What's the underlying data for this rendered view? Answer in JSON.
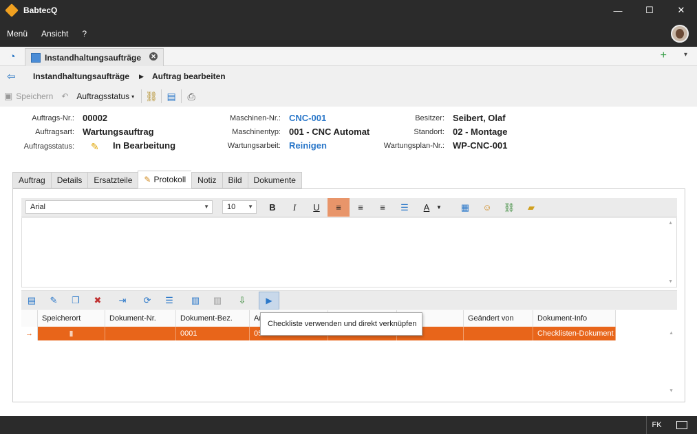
{
  "window": {
    "title": "BabtecQ",
    "minimize": "—",
    "maximize": "☐",
    "close": "✕"
  },
  "menu": [
    "Menü",
    "Ansicht",
    "?"
  ],
  "tabs": {
    "active_tab": "Instandhaltungsaufträge",
    "add": "+",
    "more": "▾"
  },
  "breadcrumb": {
    "root": "Instandhaltungsaufträge",
    "current": "Auftrag bearbeiten"
  },
  "toolbar": {
    "save": "Speichern",
    "status": "Auftragsstatus"
  },
  "order": {
    "nr_label": "Auftrags-Nr.:",
    "nr": "00002",
    "art_label": "Auftragsart:",
    "art": "Wartungsauftrag",
    "status_label": "Auftragsstatus:",
    "status": "In Bearbeitung",
    "machine_label": "Maschinen-Nr.:",
    "machine": "CNC-001",
    "type_label": "Maschinentyp:",
    "type": "001 - CNC Automat",
    "work_label": "Wartungsarbeit:",
    "work": "Reinigen",
    "owner_label": "Besitzer:",
    "owner": "Seibert, Olaf",
    "location_label": "Standort:",
    "location": "02 - Montage",
    "plan_label": "Wartungsplan-Nr.:",
    "plan": "WP-CNC-001"
  },
  "subtabs": [
    "Auftrag",
    "Details",
    "Ersatzteile",
    "Protokoll",
    "Notiz",
    "Bild",
    "Dokumente"
  ],
  "editor": {
    "font": "Arial",
    "size": "10"
  },
  "grid": {
    "headers": [
      "Speicherort",
      "Dokument-Nr.",
      "Dokument-Bez.",
      "An",
      "",
      "ert am",
      "Geändert von",
      "Dokument-Info"
    ],
    "row": {
      "marker": "→",
      "speicherort": "",
      "dok_nr": "",
      "dok_bez": "0001",
      "an": "05",
      "col5": "",
      "geaendert_am": "",
      "geaendert_von": "",
      "info": "Checklisten-Dokument"
    }
  },
  "tooltip": "Checkliste verwenden und direkt verknüpfen",
  "status": {
    "user": "FK"
  }
}
